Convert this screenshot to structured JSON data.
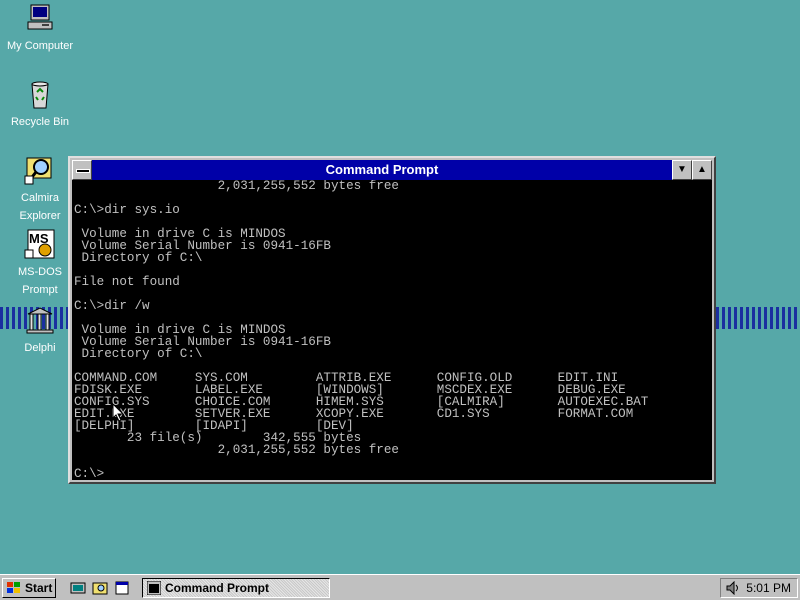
{
  "desktop": {
    "icons": [
      {
        "label": "My Computer"
      },
      {
        "label": "Recycle Bin"
      },
      {
        "label_line1": "Calmira",
        "label_line2": "Explorer"
      },
      {
        "label_line1": "MS-DOS",
        "label_line2": "Prompt",
        "glyph": "MS"
      },
      {
        "label": "Delphi"
      }
    ]
  },
  "window": {
    "title": "Command Prompt",
    "min_glyph": "▼",
    "max_glyph": "▲",
    "console_text": "                   2,031,255,552 bytes free\n\nC:\\>dir sys.io\n\n Volume in drive C is MINDOS\n Volume Serial Number is 0941-16FB\n Directory of C:\\\n\nFile not found\n\nC:\\>dir /w\n\n Volume in drive C is MINDOS\n Volume Serial Number is 0941-16FB\n Directory of C:\\\n\nCOMMAND.COM     SYS.COM         ATTRIB.EXE      CONFIG.OLD      EDIT.INI\nFDISK.EXE       LABEL.EXE       [WINDOWS]       MSCDEX.EXE      DEBUG.EXE\nCONFIG.SYS      CHOICE.COM      HIMEM.SYS       [CALMIRA]       AUTOEXEC.BAT\nEDIT.EXE        SETVER.EXE      XCOPY.EXE       CD1.SYS         FORMAT.COM\n[DELPHI]        [IDAPI]         [DEV]\n       23 file(s)        342,555 bytes\n                   2,031,255,552 bytes free\n\nC:\\>"
  },
  "taskbar": {
    "start_label": "Start",
    "task_label": "Command Prompt",
    "clock": "5:01 PM"
  },
  "colors": {
    "desktop": "#56a8a8",
    "titlebar": "#0000a8",
    "console_bg": "#000000",
    "console_fg": "#c0c0c0"
  }
}
